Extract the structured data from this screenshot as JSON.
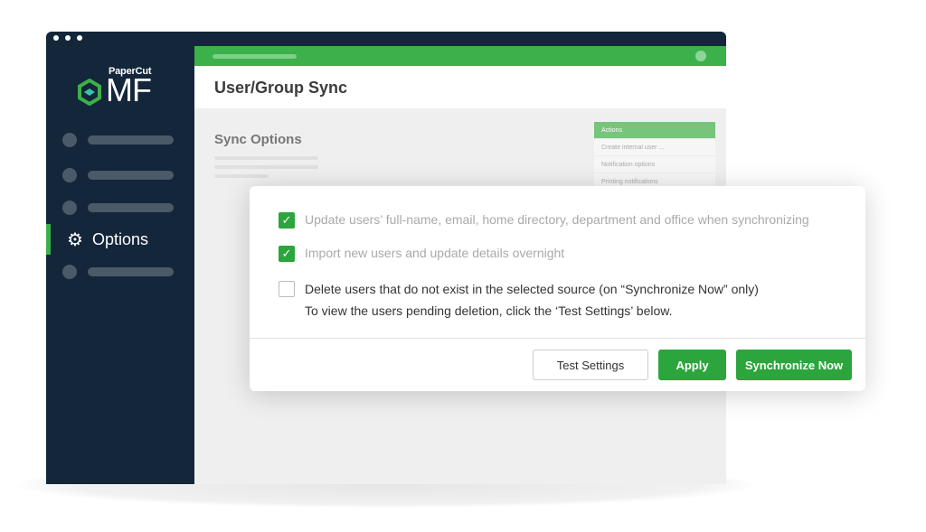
{
  "brand": {
    "small": "PaperCut",
    "tm": "™",
    "large": "MF"
  },
  "sidebar": {
    "active_item": "Options"
  },
  "page": {
    "title": "User/Group Sync",
    "section": "Sync Options"
  },
  "actions": {
    "title": "Actions",
    "items": [
      "Create internal user ...",
      "Notification options",
      "Printing notifications"
    ]
  },
  "dialog": {
    "options": [
      {
        "label": "Update users’ full-name, email, home directory, department and office when synchronizing",
        "checked": true
      },
      {
        "label": "Import new users and update details overnight",
        "checked": true
      },
      {
        "label": "Delete users that do not exist in the selected source (on “Synchronize Now” only)",
        "note": "To view the users pending deletion, click the ‘Test Settings’ below.",
        "checked": false
      }
    ],
    "buttons": {
      "test": "Test Settings",
      "apply": "Apply",
      "sync": "Synchronize Now"
    }
  },
  "colors": {
    "accent": "#3cb04a",
    "button": "#2ca53c",
    "sidebar": "#13263a"
  }
}
